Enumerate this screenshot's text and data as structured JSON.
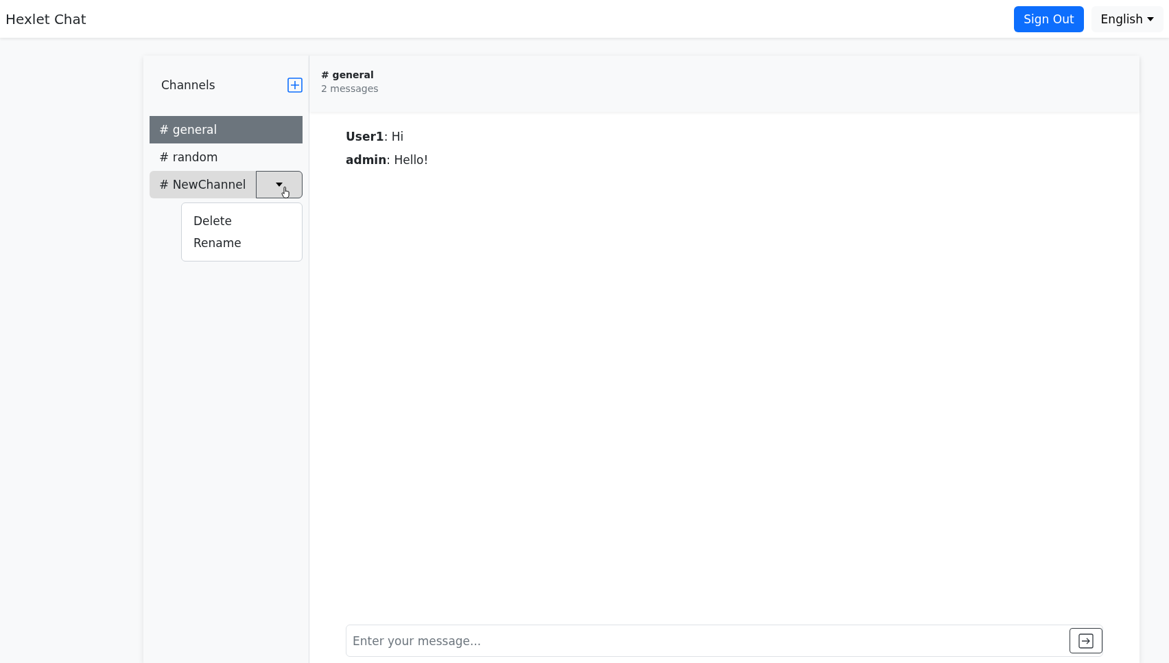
{
  "navbar": {
    "brand": "Hexlet Chat",
    "sign_out": "Sign Out",
    "language": "English"
  },
  "sidebar": {
    "title": "Channels",
    "channels": [
      {
        "kind": "default",
        "label": "# general",
        "selected": true
      },
      {
        "kind": "default",
        "label": "# random",
        "selected": false
      },
      {
        "kind": "removable",
        "label": "# NewChannel",
        "selected": false,
        "menu": {
          "expanded": true,
          "items": [
            "Delete",
            "Rename"
          ]
        }
      }
    ]
  },
  "chat": {
    "title": "# general",
    "count": "2 messages",
    "messages": [
      {
        "text": "**User1**: Hi"
      },
      {
        "text": "**admin**: Hello!"
      }
    ],
    "input": {
      "placeholder": "Enter your message..."
    }
  }
}
